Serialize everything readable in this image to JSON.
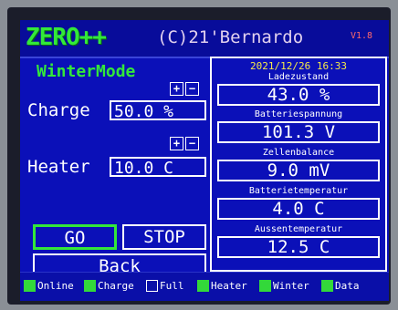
{
  "header": {
    "logo": "ZERO++",
    "copyright": "(C)21'Bernardo",
    "version": "V1.8"
  },
  "left": {
    "mode_title": "WinterMode",
    "plus_label": "+",
    "minus_label": "−",
    "charge": {
      "label": "Charge",
      "value": "50.0 %"
    },
    "heater": {
      "label": "Heater",
      "value": "10.0 C"
    },
    "buttons": {
      "go": "GO",
      "stop": "STOP",
      "back": "Back"
    }
  },
  "right": {
    "timestamp": "2021/12/26 16:33",
    "readings": [
      {
        "label": "Ladezustand",
        "value": "43.0 %"
      },
      {
        "label": "Batteriespannung",
        "value": "101.3 V"
      },
      {
        "label": "Zellenbalance",
        "value": "9.0 mV"
      },
      {
        "label": "Batterietemperatur",
        "value": "4.0 C"
      },
      {
        "label": "Aussentemperatur",
        "value": "12.5 C"
      }
    ]
  },
  "status": [
    {
      "label": "Online",
      "checked": true
    },
    {
      "label": "Charge",
      "checked": true
    },
    {
      "label": "Full",
      "checked": false
    },
    {
      "label": "Heater",
      "checked": true
    },
    {
      "label": "Winter",
      "checked": true
    },
    {
      "label": "Data",
      "checked": true
    }
  ],
  "colors": {
    "screen_bg": "#0b10b8",
    "accent_green": "#33e83a",
    "timestamp_yellow": "#f5e94a",
    "version_red": "#ff6a6a"
  }
}
